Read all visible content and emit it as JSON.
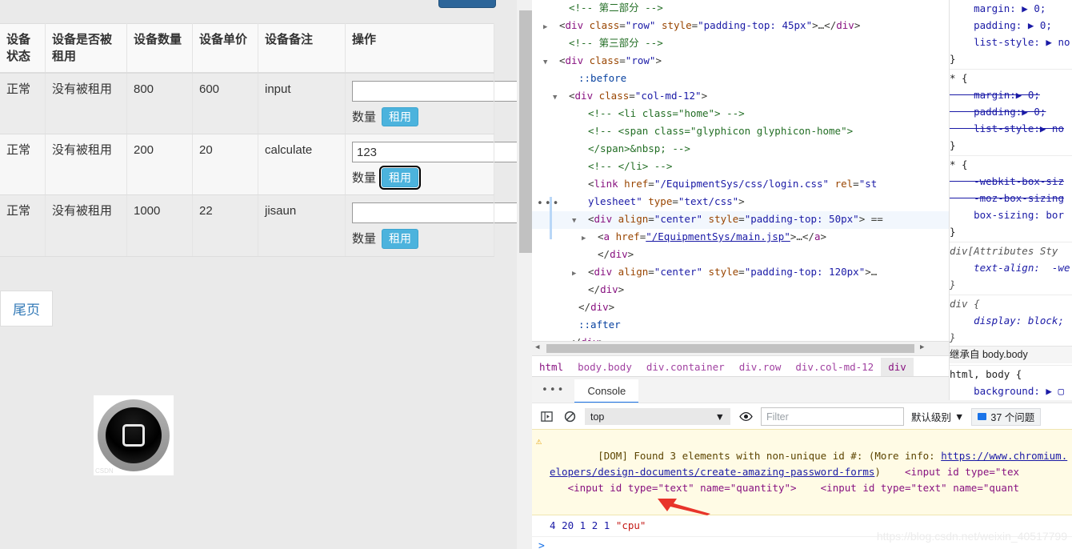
{
  "page": {
    "table": {
      "headers": [
        "设备状态",
        "设备是否被租用",
        "设备数量",
        "设备单价",
        "设备备注",
        "操作"
      ],
      "rows": [
        {
          "state": "正常",
          "rented": "没有被租用",
          "qty": "800",
          "price": "600",
          "remark": "input",
          "input_value": "",
          "qty_label": "数量",
          "rent_label": "租用",
          "focused": false
        },
        {
          "state": "正常",
          "rented": "没有被租用",
          "qty": "200",
          "price": "20",
          "remark": "calculate",
          "input_value": "123",
          "qty_label": "数量",
          "rent_label": "租用",
          "focused": true
        },
        {
          "state": "正常",
          "rented": "没有被租用",
          "qty": "1000",
          "price": "22",
          "remark": "jisaun",
          "input_value": "",
          "qty_label": "数量",
          "rent_label": "租用",
          "focused": false
        }
      ]
    },
    "pager": {
      "last_page_label": "尾页"
    },
    "home_image_alt": "home-button-image"
  },
  "devtools": {
    "elements_tree": [
      {
        "indent": 3,
        "tri": "",
        "parts": [
          {
            "t": "cmt",
            "v": "<!-- 第二部分 -->"
          }
        ]
      },
      {
        "indent": 2,
        "tri": "▶",
        "parts": [
          {
            "t": "punct",
            "v": "<"
          },
          {
            "t": "tag",
            "v": "div"
          },
          {
            "t": "attr",
            "v": " class"
          },
          {
            "t": "punct",
            "v": "="
          },
          {
            "t": "val",
            "v": "\"row\""
          },
          {
            "t": "attr",
            "v": " style"
          },
          {
            "t": "punct",
            "v": "="
          },
          {
            "t": "val",
            "v": "\"padding-top: 45px\""
          },
          {
            "t": "punct",
            "v": ">…</"
          },
          {
            "t": "tag",
            "v": "div"
          },
          {
            "t": "punct",
            "v": ">"
          }
        ]
      },
      {
        "indent": 3,
        "tri": "",
        "parts": [
          {
            "t": "cmt",
            "v": "<!-- 第三部分 -->"
          }
        ]
      },
      {
        "indent": 2,
        "tri": "▼",
        "parts": [
          {
            "t": "punct",
            "v": "<"
          },
          {
            "t": "tag",
            "v": "div"
          },
          {
            "t": "attr",
            "v": " class"
          },
          {
            "t": "punct",
            "v": "="
          },
          {
            "t": "val",
            "v": "\"row\""
          },
          {
            "t": "punct",
            "v": ">"
          }
        ]
      },
      {
        "indent": 4,
        "tri": "",
        "parts": [
          {
            "t": "pseudo",
            "v": "::before"
          }
        ]
      },
      {
        "indent": 3,
        "tri": "▼",
        "parts": [
          {
            "t": "punct",
            "v": "<"
          },
          {
            "t": "tag",
            "v": "div"
          },
          {
            "t": "attr",
            "v": " class"
          },
          {
            "t": "punct",
            "v": "="
          },
          {
            "t": "val",
            "v": "\"col-md-12\""
          },
          {
            "t": "punct",
            "v": ">"
          }
        ]
      },
      {
        "indent": 5,
        "tri": "",
        "parts": [
          {
            "t": "cmt",
            "v": "<!-- <li class=\"home\"> -->"
          }
        ]
      },
      {
        "indent": 5,
        "tri": "",
        "parts": [
          {
            "t": "cmt",
            "v": "<!-- <span class=\"glyphicon glyphicon-home\">"
          }
        ]
      },
      {
        "indent": 5,
        "tri": "",
        "parts": [
          {
            "t": "cmt",
            "v": "</span>&nbsp; -->"
          }
        ]
      },
      {
        "indent": 5,
        "tri": "",
        "parts": [
          {
            "t": "cmt",
            "v": "<!-- </li> -->"
          }
        ]
      },
      {
        "indent": 5,
        "tri": "",
        "parts": [
          {
            "t": "punct",
            "v": "<"
          },
          {
            "t": "tag",
            "v": "link"
          },
          {
            "t": "attr",
            "v": " href"
          },
          {
            "t": "punct",
            "v": "="
          },
          {
            "t": "val",
            "v": "\"/EquipmentSys/css/login.css\""
          },
          {
            "t": "attr",
            "v": " rel"
          },
          {
            "t": "punct",
            "v": "="
          },
          {
            "t": "val",
            "v": "\"st"
          }
        ]
      },
      {
        "indent": 5,
        "tri": "",
        "parts": [
          {
            "t": "val",
            "v": "ylesheet\""
          },
          {
            "t": "attr",
            "v": " type"
          },
          {
            "t": "punct",
            "v": "="
          },
          {
            "t": "val",
            "v": "\"text/css\""
          },
          {
            "t": "punct",
            "v": ">"
          }
        ]
      },
      {
        "indent": 5,
        "tri": "▼",
        "hl": true,
        "parts": [
          {
            "t": "punct",
            "v": "<"
          },
          {
            "t": "tag",
            "v": "div"
          },
          {
            "t": "attr",
            "v": " align"
          },
          {
            "t": "punct",
            "v": "="
          },
          {
            "t": "val",
            "v": "\"center\""
          },
          {
            "t": "attr",
            "v": " style"
          },
          {
            "t": "punct",
            "v": "="
          },
          {
            "t": "val",
            "v": "\"padding-top: 50px\""
          },
          {
            "t": "punct",
            "v": "> =="
          }
        ]
      },
      {
        "indent": 6,
        "tri": "▶",
        "parts": [
          {
            "t": "punct",
            "v": "<"
          },
          {
            "t": "tag",
            "v": "a"
          },
          {
            "t": "attr",
            "v": " href"
          },
          {
            "t": "punct",
            "v": "="
          },
          {
            "t": "link",
            "v": "\"/EquipmentSys/main.jsp\""
          },
          {
            "t": "punct",
            "v": ">…</"
          },
          {
            "t": "tag",
            "v": "a"
          },
          {
            "t": "punct",
            "v": ">"
          }
        ]
      },
      {
        "indent": 6,
        "tri": "",
        "parts": [
          {
            "t": "punct",
            "v": "</"
          },
          {
            "t": "tag",
            "v": "div"
          },
          {
            "t": "punct",
            "v": ">"
          }
        ]
      },
      {
        "indent": 5,
        "tri": "▶",
        "parts": [
          {
            "t": "punct",
            "v": "<"
          },
          {
            "t": "tag",
            "v": "div"
          },
          {
            "t": "attr",
            "v": " align"
          },
          {
            "t": "punct",
            "v": "="
          },
          {
            "t": "val",
            "v": "\"center\""
          },
          {
            "t": "attr",
            "v": " style"
          },
          {
            "t": "punct",
            "v": "="
          },
          {
            "t": "val",
            "v": "\"padding-top: 120px\""
          },
          {
            "t": "punct",
            "v": ">…"
          }
        ]
      },
      {
        "indent": 5,
        "tri": "",
        "parts": [
          {
            "t": "punct",
            "v": "</"
          },
          {
            "t": "tag",
            "v": "div"
          },
          {
            "t": "punct",
            "v": ">"
          }
        ]
      },
      {
        "indent": 4,
        "tri": "",
        "parts": [
          {
            "t": "punct",
            "v": "</"
          },
          {
            "t": "tag",
            "v": "div"
          },
          {
            "t": "punct",
            "v": ">"
          }
        ]
      },
      {
        "indent": 4,
        "tri": "",
        "parts": [
          {
            "t": "pseudo",
            "v": "::after"
          }
        ]
      },
      {
        "indent": 3,
        "tri": "",
        "parts": [
          {
            "t": "punct",
            "v": "</"
          },
          {
            "t": "tag",
            "v": "div"
          },
          {
            "t": "punct",
            "v": ">"
          }
        ]
      },
      {
        "indent": 3,
        "tri": "",
        "parts": [
          {
            "t": "pseudo",
            "v": "::after"
          }
        ]
      }
    ],
    "breadcrumb": [
      "html",
      "body.body",
      "div.container",
      "div.row",
      "div.col-md-12",
      "div"
    ],
    "styles_pane": [
      {
        "text": "    margin: ▶ 0;",
        "style": "prop"
      },
      {
        "text": "    padding: ▶ 0;",
        "style": "prop"
      },
      {
        "text": "    list-style: ▶ no",
        "style": "prop"
      },
      {
        "text": "}",
        "style": "brace"
      },
      {
        "text": "* {",
        "style": "sel"
      },
      {
        "text": "    margin:▶ 0;",
        "style": "strike"
      },
      {
        "text": "    padding:▶ 0;",
        "style": "strike"
      },
      {
        "text": "    list-style:▶ no",
        "style": "strike"
      },
      {
        "text": "}",
        "style": "brace"
      },
      {
        "text": "* {",
        "style": "sel"
      },
      {
        "text": "    -webkit-box-siz",
        "style": "strike"
      },
      {
        "text": "    -moz-box-sizing",
        "style": "strike"
      },
      {
        "text": "    box-sizing: bor",
        "style": "prop"
      },
      {
        "text": "}",
        "style": "brace"
      },
      {
        "text": "div[Attributes Sty",
        "style": "sel-i"
      },
      {
        "text": "    text-align:  -we",
        "style": "prop-i"
      },
      {
        "text": "}",
        "style": "brace-i"
      },
      {
        "text": "div {",
        "style": "sel-i"
      },
      {
        "text": "    display: block;",
        "style": "prop-i"
      },
      {
        "text": "}",
        "style": "brace-i"
      },
      {
        "text": "继承自 body.body",
        "style": "inherit"
      },
      {
        "text": "html, body {",
        "style": "sel"
      },
      {
        "text": "    background: ▶ ▢",
        "style": "prop"
      }
    ],
    "console": {
      "tab_label": "Console",
      "context": "top",
      "filter_placeholder": "Filter",
      "level_label": "默认级别",
      "issues_label": "37 个问题",
      "messages": [
        {
          "type": "warning",
          "text_parts": [
            {
              "t": "plain",
              "v": "[DOM] Found 3 elements with non-unique id #: (More info: "
            },
            {
              "t": "link",
              "v": "https://www.chromium.org/dev\neloper s/design-documents/create-amazing-password-forms"
            },
            {
              "t": "plain",
              "v": ") "
            }
          ],
          "line1": "[DOM] Found 3 elements with non-unique id #: (More info: ",
          "link1": "https://www.chromium.",
          "link2": "elopers/design-documents/create-amazing-password-forms",
          "after_link": ")",
          "snippet1": "<input id type=\"tex",
          "snippet2": "<input id type=\"text\" name=\"quantity\">",
          "snippet3": "<input id type=\"text\" name=\"quant"
        },
        {
          "type": "output",
          "values": [
            "4",
            "20",
            "1",
            "2",
            "1"
          ],
          "string_value": "\"cpu\""
        }
      ],
      "prompt": ">"
    }
  },
  "watermark": "https://blog.csdn.net/weixin_40517799",
  "colors": {
    "accent_blue": "#1a73e8",
    "rent_button": "#4cb3dd",
    "page_bg": "#eaeaea",
    "warn_bg": "#fffbe5",
    "top_button": "#2c6599"
  }
}
